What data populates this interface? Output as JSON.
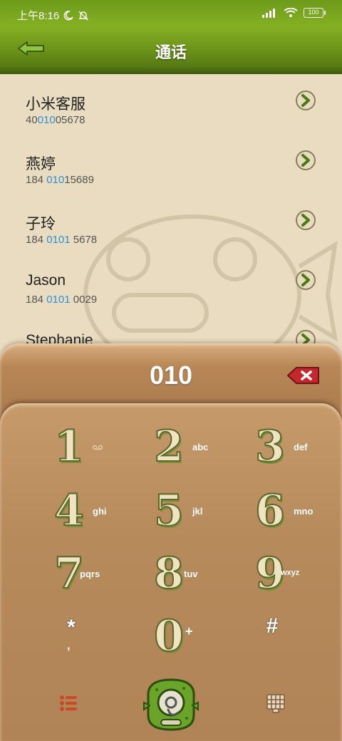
{
  "status": {
    "time": "上午8:16",
    "battery": "100"
  },
  "header": {
    "title": "通话"
  },
  "contacts": [
    {
      "name": "小米客服",
      "num_pre": "40",
      "num_hl": "010",
      "num_post": "05678"
    },
    {
      "name": "燕婷",
      "num_pre": "184 ",
      "num_hl": "010",
      "num_post": "15689"
    },
    {
      "name": "子玲",
      "num_pre": "184 ",
      "num_hl": "0101",
      "num_post": " 5678"
    },
    {
      "name": "Jason",
      "num_pre": "184 ",
      "num_hl": "0101",
      "num_post": " 0029"
    },
    {
      "name": "Stephanie",
      "num_pre": "",
      "num_hl": "",
      "num_post": ""
    }
  ],
  "dialer": {
    "display": "010",
    "keys": [
      {
        "digit": "1",
        "letters": ""
      },
      {
        "digit": "2",
        "letters": "abc"
      },
      {
        "digit": "3",
        "letters": "def"
      },
      {
        "digit": "4",
        "letters": "ghi"
      },
      {
        "digit": "5",
        "letters": "jkl"
      },
      {
        "digit": "6",
        "letters": "mno"
      },
      {
        "digit": "7",
        "letters": "pqrs"
      },
      {
        "digit": "8",
        "letters": "tuv"
      },
      {
        "digit": "9",
        "letters": "wxyz"
      },
      {
        "digit": "*",
        "letters": ","
      },
      {
        "digit": "0",
        "letters": "+"
      },
      {
        "digit": "#",
        "letters": ""
      }
    ]
  },
  "icons": {
    "back": "back-arrow-icon",
    "arrow": "chevron-right-icon",
    "delete": "backspace-icon",
    "menu": "list-menu-icon",
    "call": "fish-call-icon",
    "keypad": "keypad-grid-icon"
  },
  "colors": {
    "header_green": "#7aa81f",
    "list_bg": "#e9dcc0",
    "dialer_brown": "#b88656",
    "highlight_blue": "#2f8fd8"
  }
}
